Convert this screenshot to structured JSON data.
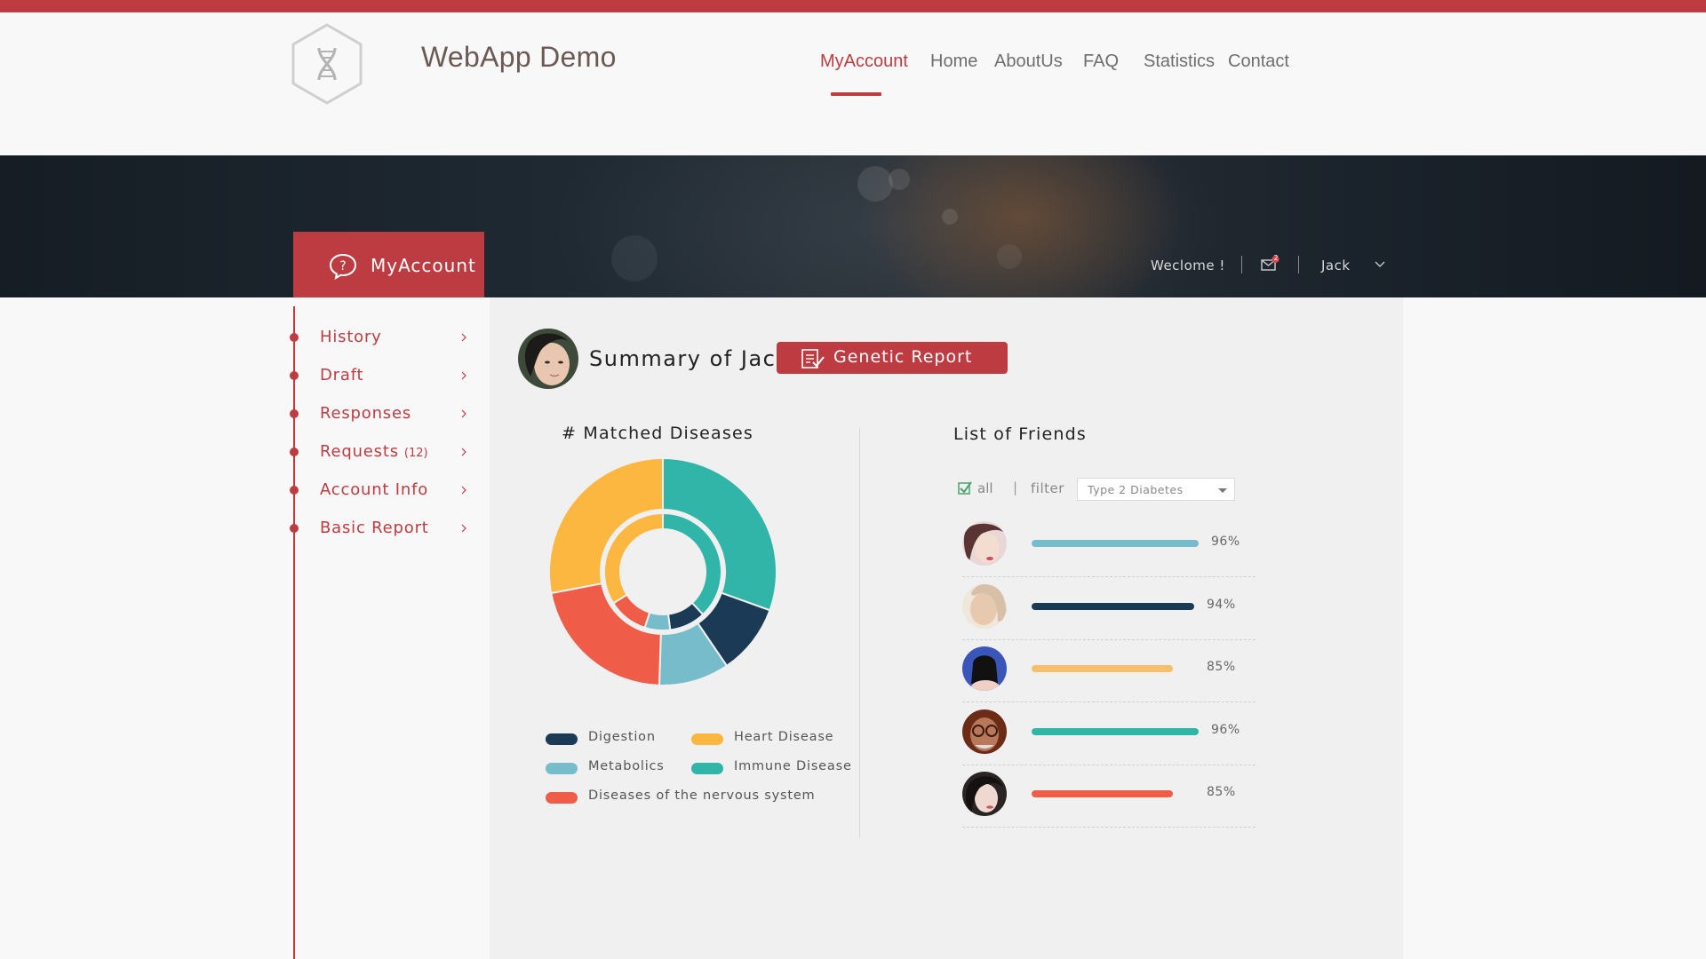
{
  "app": {
    "title": "WebApp Demo",
    "logo_icon": "dna-hexagon-icon"
  },
  "nav": {
    "items": [
      {
        "label": "MyAccount",
        "active": true
      },
      {
        "label": "Home",
        "active": false
      },
      {
        "label": "AboutUs",
        "active": false
      },
      {
        "label": "FAQ",
        "active": false
      },
      {
        "label": "Statistics",
        "active": false
      },
      {
        "label": "Contact",
        "active": false
      }
    ]
  },
  "banner": {
    "tab_label": "MyAccount",
    "tab_icon": "question-bubble-icon",
    "welcome": "Weclome !",
    "mail_badge": "2",
    "user_name": "Jack"
  },
  "sidebar": {
    "items": [
      {
        "label": "History",
        "count": ""
      },
      {
        "label": "Draft",
        "count": ""
      },
      {
        "label": "Responses",
        "count": ""
      },
      {
        "label": "Requests",
        "count": "(12)"
      },
      {
        "label": "Account Info",
        "count": ""
      },
      {
        "label": "Basic Report",
        "count": ""
      }
    ]
  },
  "summary": {
    "title": "Summary of Jack",
    "report_button": "Genetic Report"
  },
  "diseases": {
    "title": "# Matched Diseases",
    "legend": [
      {
        "label": "Digestion",
        "color": "#1b3a55"
      },
      {
        "label": "Heart Disease",
        "color": "#fbb73f"
      },
      {
        "label": "Metabolics",
        "color": "#76bccb"
      },
      {
        "label": "Immune Disease",
        "color": "#31b5a8"
      },
      {
        "label": "Diseases of the nervous system",
        "color": "#ef5c48"
      }
    ]
  },
  "chart_data": {
    "type": "pie",
    "title": "# Matched Diseases",
    "categories": [
      "Immune Disease",
      "Digestion",
      "Metabolics",
      "Diseases of the nervous system",
      "Heart Disease"
    ],
    "series": [
      {
        "values": [
          30.5,
          10,
          10,
          21.5,
          28
        ]
      },
      {
        "values": [
          38,
          10,
          7,
          11,
          34
        ]
      }
    ],
    "colors": [
      "#31b5a8",
      "#1b3a55",
      "#76bccb",
      "#ef5c48",
      "#fbb73f"
    ]
  },
  "friends": {
    "title": "List of Friends",
    "filter_all": "all",
    "filter_pipe": "|",
    "filter_label": "filter",
    "filter_value": "Type 2 Diabetes",
    "rows": [
      {
        "percent": "96%",
        "value": 96,
        "color": "#76bccb"
      },
      {
        "percent": "94%",
        "value": 94,
        "color": "#1b3a55"
      },
      {
        "percent": "85%",
        "value": 85,
        "color": "#f5bf6b"
      },
      {
        "percent": "96%",
        "value": 96,
        "color": "#31b5a8"
      },
      {
        "percent": "85%",
        "value": 85,
        "color": "#ef5c48"
      }
    ]
  }
}
